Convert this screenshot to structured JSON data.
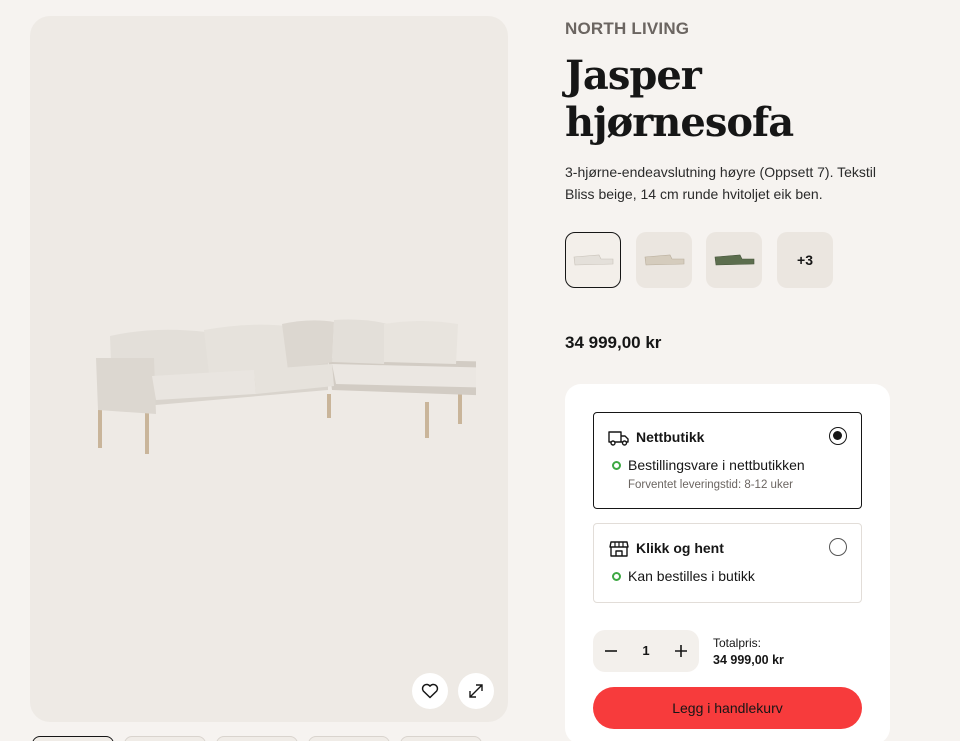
{
  "brand": "NORTH LIVING",
  "product": {
    "title": "Jasper hjørnesofa",
    "description": "3-hjørne-endeavslutning høyre (Oppsett 7). Tekstil Bliss beige, 14 cm runde hvitoljet eik ben.",
    "price": "34 999,00 kr"
  },
  "gallery": {
    "image_icon": "corner-sofa-image",
    "favorite_icon": "heart-icon",
    "zoom_icon": "expand-icon"
  },
  "variants": [
    {
      "icon": "sofa-beige-light",
      "color": "#e4e0da"
    },
    {
      "icon": "sofa-beige",
      "color": "#d5ccbd"
    },
    {
      "icon": "sofa-green",
      "color": "#5c6e4e"
    }
  ],
  "variants_more": "+3",
  "delivery": {
    "online": {
      "title": "Nettbutikk",
      "status": "Bestillingsvare i nettbutikken",
      "sub": "Forventet leveringstid: 8-12 uker",
      "selected": true
    },
    "pickup": {
      "title": "Klikk og hent",
      "status": "Kan bestilles i butikk",
      "selected": false
    }
  },
  "cart": {
    "quantity": "1",
    "total_label": "Totalpris:",
    "total_value": "34 999,00 kr",
    "add_label": "Legg i handlekurv"
  },
  "colors": {
    "accent": "#f73b3c",
    "status_ok": "#3da843",
    "background": "#f6f3f0",
    "gallery_bg": "#eeeae5"
  }
}
